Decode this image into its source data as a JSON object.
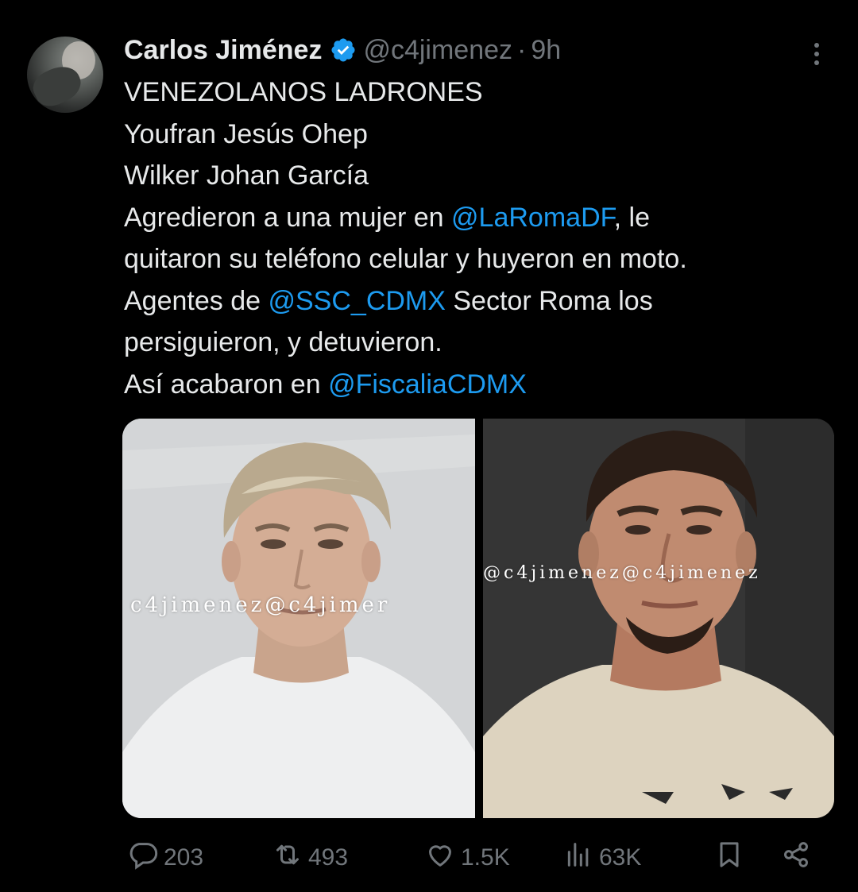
{
  "author": {
    "name": "Carlos Jiménez",
    "handle": "@c4jimenez",
    "separator": "·",
    "time": "9h"
  },
  "tweet": {
    "lines": [
      [
        {
          "text": "VENEZOLANOS LADRONES",
          "type": "text"
        }
      ],
      [
        {
          "text": "Youfran Jesús Ohep",
          "type": "text"
        }
      ],
      [
        {
          "text": "Wilker Johan García",
          "type": "text"
        }
      ],
      [
        {
          "text": "Agredieron a una mujer en ",
          "type": "text"
        },
        {
          "text": "@LaRomaDF",
          "type": "mention"
        },
        {
          "text": ", le",
          "type": "text"
        }
      ],
      [
        {
          "text": "quitaron su teléfono celular y huyeron en moto.",
          "type": "text"
        }
      ],
      [
        {
          "text": "Agentes de ",
          "type": "text"
        },
        {
          "text": "@SSC_CDMX",
          "type": "mention"
        },
        {
          "text": " Sector Roma los",
          "type": "text"
        }
      ],
      [
        {
          "text": "persiguieron, y detuvieron.",
          "type": "text"
        }
      ],
      [
        {
          "text": "Así acabaron en ",
          "type": "text"
        },
        {
          "text": "@FiscaliaCDMX",
          "type": "mention"
        }
      ]
    ]
  },
  "media": {
    "left_watermark": "c4jimenez@c4jimer",
    "right_watermark": "@c4jimenez@c4jimenez"
  },
  "actions": {
    "replies": "203",
    "reposts": "493",
    "likes": "1.5K",
    "views": "63K"
  },
  "colors": {
    "background": "#000000",
    "text": "#e7e9ea",
    "secondary": "#71767b",
    "link": "#1d9bf0",
    "verified": "#1d9bf0"
  },
  "icons": [
    "verified-badge-icon",
    "more-icon",
    "reply-icon",
    "repost-icon",
    "like-icon",
    "views-icon",
    "bookmark-icon",
    "share-icon"
  ]
}
